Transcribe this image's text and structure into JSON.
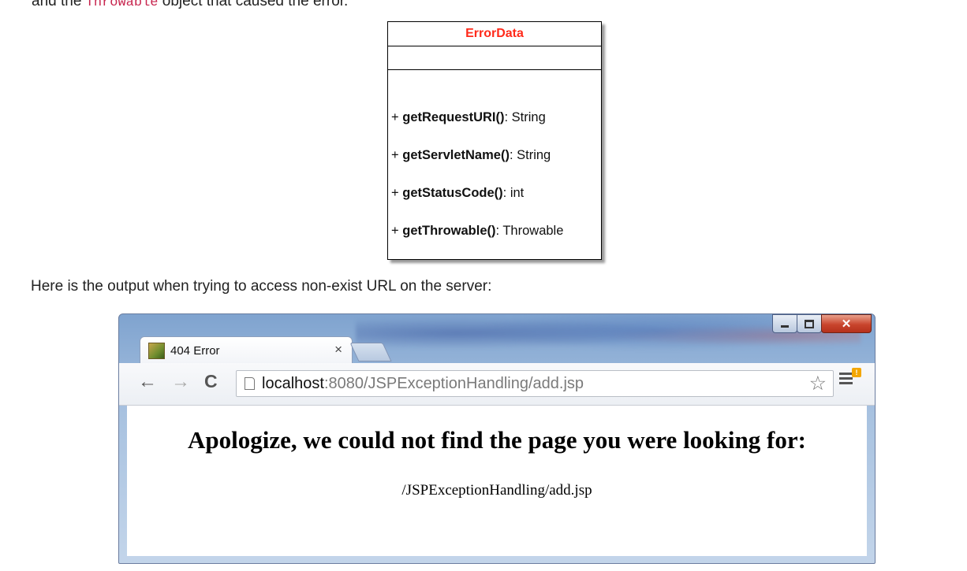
{
  "intro": {
    "prefix": "and the ",
    "code": "Throwable",
    "suffix": " object that caused the error."
  },
  "uml": {
    "class_name": "ErrorData",
    "operations": [
      {
        "visibility": "+",
        "name": "getRequestURI()",
        "type": ": String"
      },
      {
        "visibility": "+",
        "name": "getServletName()",
        "type": ": String"
      },
      {
        "visibility": "+",
        "name": "getStatusCode()",
        "type": ": int"
      },
      {
        "visibility": "+",
        "name": "getThrowable()",
        "type": ": Throwable"
      }
    ],
    "title_color": "#ff2a1a"
  },
  "caption": "Here is the output when trying to access non-exist URL on the server:",
  "browser": {
    "tab_title": "404 Error",
    "tab_close": "×",
    "url_host": "localhost",
    "url_rest": ":8080/JSPExceptionHandling/add.jsp",
    "menu_badge": "!",
    "icons": {
      "back": "arrow-left-icon",
      "forward": "arrow-right-icon",
      "reload": "reload-icon",
      "page": "page-icon",
      "star": "star-icon",
      "menu": "hamburger-menu-icon"
    }
  },
  "page": {
    "heading": "Apologize, we could not find the page you were looking for:",
    "path": "/JSPExceptionHandling/add.jsp"
  }
}
